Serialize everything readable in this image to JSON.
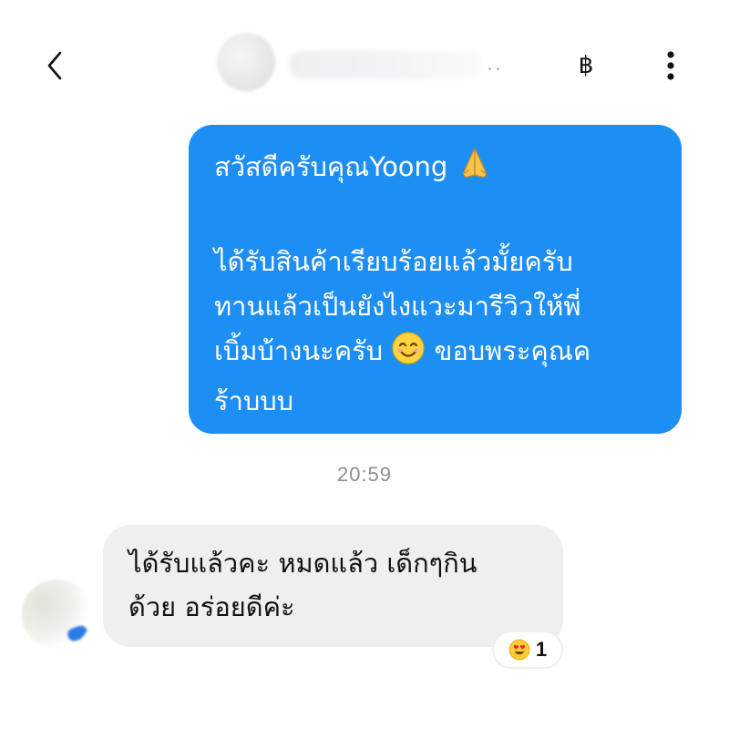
{
  "header": {
    "contact_name_hidden": "..",
    "currency_label": "฿"
  },
  "colors": {
    "outgoing_bubble": "#1d8ef3",
    "incoming_bubble": "#efefef",
    "timestamp": "#8e8e93"
  },
  "messages": {
    "outgoing": {
      "line1_text": "สวัสดีครับคุณYoong ",
      "line1_emoji": "folded-hands-emoji",
      "paragraph2_a": "ได้รับสินค้าเรียบร้อยแล้วมั้ยครับ\nทานแล้วเป็นยังไงแวะมารีวิวให้พี่\nเบิ้มบ้างนะครับ ",
      "paragraph2_emoji": "smiling-face-emoji",
      "paragraph2_b": " ขอบพระคุณค\nร้าบบบ"
    },
    "timestamp": "20:59",
    "incoming": {
      "text": "ได้รับแล้วคะ หมดแล้ว เด็กๆกิน\nด้วย อร่อยดีค่ะ",
      "reaction_emoji": "heart-eyes-emoji",
      "reaction_count": "1"
    }
  }
}
